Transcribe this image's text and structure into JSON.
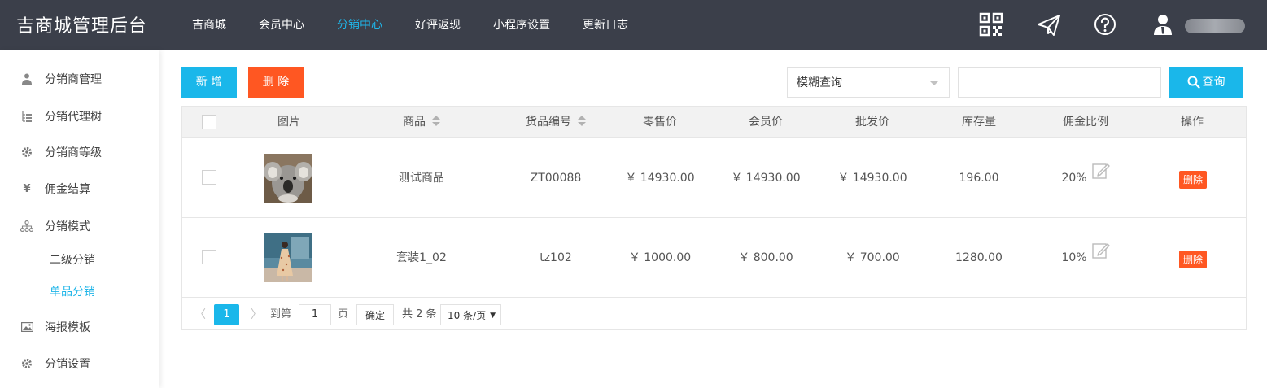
{
  "app": {
    "title": "吉商城管理后台"
  },
  "nav": {
    "items": [
      {
        "label": "吉商城"
      },
      {
        "label": "会员中心"
      },
      {
        "label": "分销中心"
      },
      {
        "label": "好评返现"
      },
      {
        "label": "小程序设置"
      },
      {
        "label": "更新日志"
      }
    ],
    "active_index": 2
  },
  "header_icons": [
    "qrcode-icon",
    "send-icon",
    "help-icon",
    "user-icon"
  ],
  "sidebar": {
    "items": [
      {
        "label": "分销商管理",
        "icon": "user-icon"
      },
      {
        "label": "分销代理树",
        "icon": "tree-icon"
      },
      {
        "label": "分销商等级",
        "icon": "gear-icon"
      },
      {
        "label": "佣金结算",
        "icon": "yen-icon"
      },
      {
        "label": "分销模式",
        "icon": "hierarchy-icon"
      },
      {
        "label": "海报模板",
        "icon": "image-icon"
      },
      {
        "label": "分销设置",
        "icon": "gear-icon"
      }
    ],
    "subitems": [
      {
        "label": "二级分销",
        "active": false
      },
      {
        "label": "单品分销",
        "active": true
      }
    ]
  },
  "toolbar": {
    "add_label": "新 增",
    "delete_label": "删 除",
    "filter_select": "模糊查询",
    "search_value": "",
    "search_label": "查询"
  },
  "table": {
    "columns": [
      "图片",
      "商品",
      "货品编号",
      "零售价",
      "会员价",
      "批发价",
      "库存量",
      "佣金比例",
      "操作"
    ],
    "rows": [
      {
        "name": "测试商品",
        "code": "ZT00088",
        "retail": "￥ 14930.00",
        "member": "￥ 14930.00",
        "wholesale": "￥ 14930.00",
        "stock": "196.00",
        "commission": "20%",
        "action": "删除",
        "image": "koala photo"
      },
      {
        "name": "套装1_02",
        "code": "tz102",
        "retail": "￥ 1000.00",
        "member": "￥ 800.00",
        "wholesale": "￥ 700.00",
        "stock": "1280.00",
        "commission": "10%",
        "action": "删除",
        "image": "dress model photo"
      }
    ]
  },
  "pager": {
    "current_page": "1",
    "goto_label": "到第",
    "goto_value": "1",
    "page_unit": "页",
    "confirm_label": "确定",
    "total_label": "共 2 条",
    "page_size": "10 条/页"
  },
  "colors": {
    "header_bg": "#3b3f4a",
    "accent": "#1ab7ea",
    "danger": "#ff5722"
  }
}
